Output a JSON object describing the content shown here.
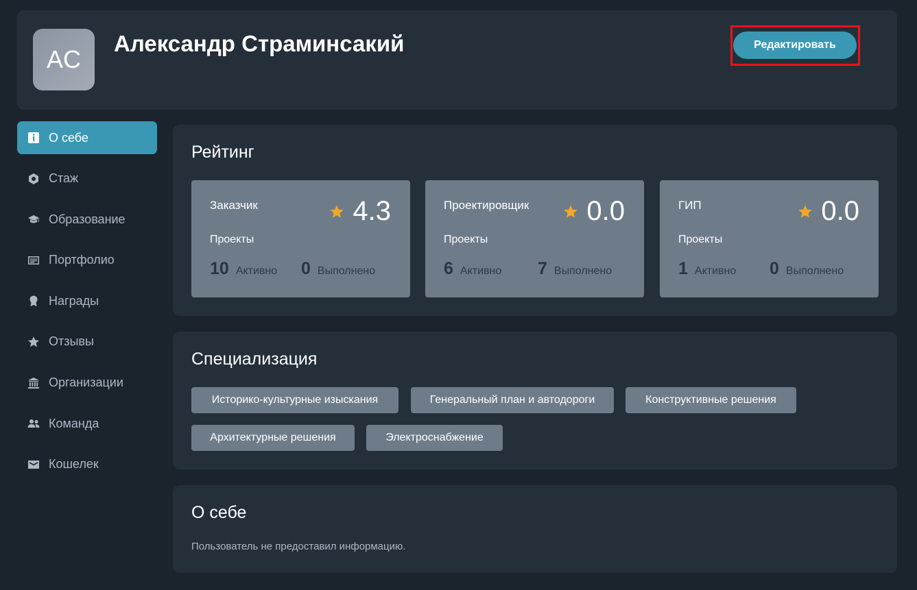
{
  "profile": {
    "initials": "AC",
    "name": "Александр Страминсакий",
    "edit_label": "Редактировать"
  },
  "sidebar": {
    "items": [
      {
        "label": "О себе",
        "icon": "info-icon",
        "active": true
      },
      {
        "label": "Стаж",
        "icon": "hexagon-icon"
      },
      {
        "label": "Образование",
        "icon": "graduation-cap-icon"
      },
      {
        "label": "Портфолио",
        "icon": "document-icon"
      },
      {
        "label": "Награды",
        "icon": "award-icon"
      },
      {
        "label": "Отзывы",
        "icon": "star-icon"
      },
      {
        "label": "Организации",
        "icon": "building-icon"
      },
      {
        "label": "Команда",
        "icon": "team-icon"
      },
      {
        "label": "Кошелек",
        "icon": "wallet-icon"
      }
    ]
  },
  "rating": {
    "title": "Рейтинг",
    "projects_label": "Проекты",
    "active_label": "Активно",
    "done_label": "Выполнено",
    "boxes": [
      {
        "role": "Заказчик",
        "score": "4.3",
        "active": "10",
        "done": "0"
      },
      {
        "role": "Проектировщик",
        "score": "0.0",
        "active": "6",
        "done": "7"
      },
      {
        "role": "ГИП",
        "score": "0.0",
        "active": "1",
        "done": "0"
      }
    ]
  },
  "specialization": {
    "title": "Специализация",
    "tags": [
      "Историко-культурные изыскания",
      "Генеральный план и автодороги",
      "Конструктивные решения",
      "Архитектурные решения",
      "Электроснабжение"
    ]
  },
  "about": {
    "title": "О себе",
    "text": "Пользователь не предоставил информацию."
  },
  "colors": {
    "background": "#1b242d",
    "panel": "#252f39",
    "accent": "#3a98b4",
    "box": "#6e7c8a",
    "star": "#f5a623",
    "highlight": "#e8141b"
  }
}
